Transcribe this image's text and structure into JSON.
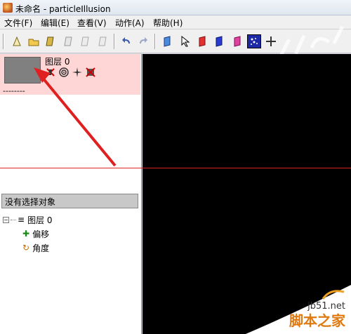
{
  "window": {
    "title": "未命名 - particleIllusion"
  },
  "menu": {
    "items": [
      "文件(F)",
      "编辑(E)",
      "查看(V)",
      "动作(A)",
      "帮助(H)"
    ]
  },
  "toolbar": {
    "buttons": [
      "new-icon",
      "open-icon",
      "save-icon",
      "cut-icon",
      "copy-icon",
      "paste-icon",
      "undo-icon",
      "redo-icon",
      "emitter-icon",
      "select-icon",
      "deflector-icon",
      "blocker-icon",
      "layer-icon",
      "particle-mode-icon",
      "move-icon"
    ]
  },
  "layer_panel": {
    "layer_name": "图层 0",
    "dash": "--------"
  },
  "selection": {
    "header": "没有选择对象",
    "tree": {
      "root": "图层 0",
      "children": [
        "偏移",
        "角度"
      ]
    }
  },
  "watermark": {
    "url": "jb51.net",
    "name": "脚本之家"
  },
  "colors": {
    "layer_highlight": "#ffd6d6",
    "canvas": "#000000",
    "arrow": "#e02020",
    "active_tool": "#1d2aa8"
  }
}
